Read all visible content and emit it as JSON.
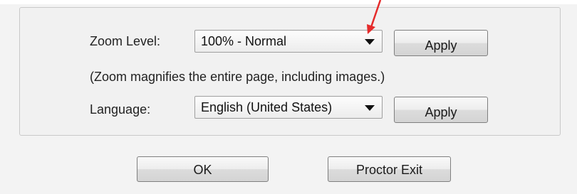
{
  "settings": {
    "zoom": {
      "label": "Zoom Level:",
      "selected": "100% - Normal",
      "apply_label": "Apply"
    },
    "zoom_note": "(Zoom magnifies the entire page, including images.)",
    "language": {
      "label": "Language:",
      "selected": "English (United States)",
      "apply_label": "Apply"
    }
  },
  "actions": {
    "ok_label": "OK",
    "proctor_exit_label": "Proctor Exit"
  },
  "colors": {
    "annotation_arrow": "#e52b2b",
    "panel_background": "#f1f1f1",
    "page_background": "#f3f3f3"
  },
  "icons": {
    "dropdown": "chevron-down-icon",
    "annotation": "red-arrow-annotation"
  }
}
